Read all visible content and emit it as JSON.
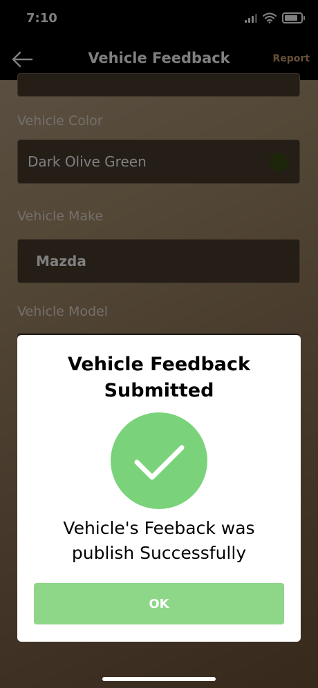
{
  "status_bar": {
    "time": "7:10"
  },
  "nav": {
    "back_icon": "arrow-left-icon",
    "title": "Vehicle Feedback",
    "report_label": "Report"
  },
  "form": {
    "color_label": "Vehicle Color",
    "color_value": "Dark Olive Green",
    "swatch_color": "#3a4a16",
    "make_label": "Vehicle Make",
    "make_value": "Mazda",
    "model_label": "Vehicle Model"
  },
  "modal": {
    "title_line1": "Vehicle Feedback",
    "title_line2": "Submitted",
    "icon": "checkmark-icon",
    "message_line1": "Vehicle's Feeback was",
    "message_line2": "publish Successfully",
    "ok_label": "OK",
    "accent_color": "#7ad37a"
  }
}
